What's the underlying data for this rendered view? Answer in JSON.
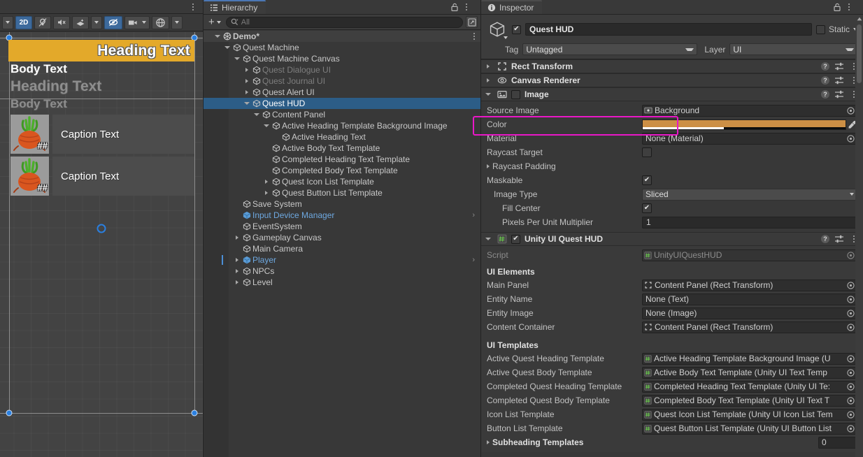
{
  "scene": {
    "toolbar": {
      "dropdown_caret": "▾",
      "mode_2d": "2D",
      "lighting_icon": "lighting-icon",
      "audio_icon": "audio-mute-icon",
      "fx_icon": "effects-icon",
      "fx_caret": "▾",
      "visibility_icon": "scene-visibility-icon",
      "camera_icon": "scene-camera-icon",
      "camera_caret": "▾",
      "gizmos_icon": "gizmos-icon",
      "gizmos_caret": "▾"
    },
    "hud_preview": {
      "heading_text": "Heading Text",
      "body_text": "Body Text",
      "completed_heading_text": "Heading Text",
      "completed_body_text": "Body Text",
      "icon_count_1": "##",
      "caption_1": "Caption Text",
      "icon_count_2": "##",
      "caption_2": "Caption Text",
      "heading_bg_color": "#e3a92a"
    }
  },
  "hierarchy": {
    "tab_label": "Hierarchy",
    "add_label": "",
    "add_caret": "▾",
    "search_placeholder": "All",
    "rows": [
      {
        "label": "Demo*",
        "indent": 1,
        "twist": "open",
        "type": "scene",
        "dim": false,
        "prefab": false,
        "selected": false,
        "kebab": true
      },
      {
        "label": "Quest Machine",
        "indent": 2,
        "twist": "open",
        "type": "go",
        "dim": false,
        "prefab": false,
        "selected": false,
        "kebab": false
      },
      {
        "label": "Quest Machine Canvas",
        "indent": 3,
        "twist": "open",
        "type": "go",
        "dim": false,
        "prefab": false,
        "selected": false,
        "kebab": false
      },
      {
        "label": "Quest Dialogue UI",
        "indent": 4,
        "twist": "closed",
        "type": "go",
        "dim": true,
        "prefab": false,
        "selected": false,
        "kebab": false
      },
      {
        "label": "Quest Journal UI",
        "indent": 4,
        "twist": "closed",
        "type": "go",
        "dim": true,
        "prefab": false,
        "selected": false,
        "kebab": false
      },
      {
        "label": "Quest Alert UI",
        "indent": 4,
        "twist": "closed",
        "type": "go",
        "dim": false,
        "prefab": false,
        "selected": false,
        "kebab": false
      },
      {
        "label": "Quest HUD",
        "indent": 4,
        "twist": "open",
        "type": "go",
        "dim": false,
        "prefab": false,
        "selected": true,
        "kebab": false
      },
      {
        "label": "Content Panel",
        "indent": 5,
        "twist": "open",
        "type": "go",
        "dim": false,
        "prefab": false,
        "selected": false,
        "kebab": false
      },
      {
        "label": "Active Heading Template Background Image",
        "indent": 6,
        "twist": "open",
        "type": "go",
        "dim": false,
        "prefab": false,
        "selected": false,
        "kebab": false
      },
      {
        "label": "Active Heading Text",
        "indent": 7,
        "twist": "none",
        "type": "go",
        "dim": false,
        "prefab": false,
        "selected": false,
        "kebab": false
      },
      {
        "label": "Active Body Text Template",
        "indent": 6,
        "twist": "none",
        "type": "go",
        "dim": false,
        "prefab": false,
        "selected": false,
        "kebab": false
      },
      {
        "label": "Completed Heading Text Template",
        "indent": 6,
        "twist": "none",
        "type": "go",
        "dim": false,
        "prefab": false,
        "selected": false,
        "kebab": false
      },
      {
        "label": "Completed Body Text Template",
        "indent": 6,
        "twist": "none",
        "type": "go",
        "dim": false,
        "prefab": false,
        "selected": false,
        "kebab": false
      },
      {
        "label": "Quest Icon List Template",
        "indent": 6,
        "twist": "closed",
        "type": "go",
        "dim": false,
        "prefab": false,
        "selected": false,
        "kebab": false
      },
      {
        "label": "Quest Button List Template",
        "indent": 6,
        "twist": "closed",
        "type": "go",
        "dim": false,
        "prefab": false,
        "selected": false,
        "kebab": false
      },
      {
        "label": "Save System",
        "indent": 3,
        "twist": "none",
        "type": "go",
        "dim": false,
        "prefab": false,
        "selected": false,
        "kebab": false
      },
      {
        "label": "Input Device Manager",
        "indent": 3,
        "twist": "none",
        "type": "prefab",
        "dim": false,
        "prefab": true,
        "selected": false,
        "kebab": false,
        "chev": "›"
      },
      {
        "label": "EventSystem",
        "indent": 3,
        "twist": "none",
        "type": "go",
        "dim": false,
        "prefab": false,
        "selected": false,
        "kebab": false
      },
      {
        "label": "Gameplay Canvas",
        "indent": 3,
        "twist": "closed",
        "type": "go",
        "dim": false,
        "prefab": false,
        "selected": false,
        "kebab": false
      },
      {
        "label": "Main Camera",
        "indent": 3,
        "twist": "none",
        "type": "go",
        "dim": false,
        "prefab": false,
        "selected": false,
        "kebab": false
      },
      {
        "label": "Player",
        "indent": 3,
        "twist": "closed",
        "type": "prefab",
        "dim": false,
        "prefab": true,
        "selected": false,
        "kebab": false,
        "chev": "›",
        "stripe": true
      },
      {
        "label": "NPCs",
        "indent": 3,
        "twist": "closed",
        "type": "go",
        "dim": false,
        "prefab": false,
        "selected": false,
        "kebab": false
      },
      {
        "label": "Level",
        "indent": 3,
        "twist": "closed",
        "type": "go",
        "dim": false,
        "prefab": false,
        "selected": false,
        "kebab": false
      }
    ]
  },
  "inspector": {
    "tab_label": "Inspector",
    "object_name": "Quest HUD",
    "object_enabled": true,
    "static_label": "Static",
    "static_checked": false,
    "tag_label": "Tag",
    "tag_value": "Untagged",
    "layer_label": "Layer",
    "layer_value": "UI",
    "components": [
      {
        "name": "Rect Transform",
        "expanded": false,
        "icon": "rect-transform-icon",
        "has_toggle": false
      },
      {
        "name": "Canvas Renderer",
        "expanded": false,
        "icon": "canvas-renderer-icon",
        "has_toggle": false
      }
    ],
    "image_component": {
      "name": "Image",
      "expanded": true,
      "enabled": false,
      "rows": {
        "source_image_label": "Source Image",
        "source_image_value": "Background",
        "color_label": "Color",
        "color_value": "#cc8f45",
        "color_alpha_pct": 40,
        "material_label": "Material",
        "material_value": "None (Material)",
        "raycast_target_label": "Raycast Target",
        "raycast_target_checked": false,
        "raycast_padding_label": "Raycast Padding",
        "maskable_label": "Maskable",
        "maskable_checked": true,
        "image_type_label": "Image Type",
        "image_type_value": "Sliced",
        "fill_center_label": "Fill Center",
        "fill_center_checked": true,
        "ppu_label": "Pixels Per Unit Multiplier",
        "ppu_value": "1"
      }
    },
    "script_component": {
      "name": "Unity UI Quest HUD",
      "expanded": true,
      "enabled": true,
      "script_label": "Script",
      "script_value": "UnityUIQuestHUD",
      "ui_elements_title": "UI Elements",
      "ui_elements": [
        {
          "label": "Main Panel",
          "value": "Content Panel (Rect Transform)",
          "badge": "rect-transform-icon"
        },
        {
          "label": "Entity Name",
          "value": "None (Text)",
          "badge": "none"
        },
        {
          "label": "Entity Image",
          "value": "None (Image)",
          "badge": "none"
        },
        {
          "label": "Content Container",
          "value": "Content Panel (Rect Transform)",
          "badge": "rect-transform-icon"
        }
      ],
      "ui_templates_title": "UI Templates",
      "ui_templates": [
        {
          "label": "Active Quest Heading Template",
          "value": "Active Heading Template Background Image (U",
          "badge": "script-icon"
        },
        {
          "label": "Active Quest Body Template",
          "value": "Active Body Text Template (Unity UI Text Temp",
          "badge": "script-icon"
        },
        {
          "label": "Completed Quest Heading Template",
          "value": "Completed Heading Text Template (Unity UI Te:",
          "badge": "script-icon"
        },
        {
          "label": "Completed Quest Body Template",
          "value": "Completed Body Text Template (Unity UI Text T",
          "badge": "script-icon"
        },
        {
          "label": "Icon List Template",
          "value": "Quest Icon List Template (Unity UI Icon List Tem",
          "badge": "script-icon"
        },
        {
          "label": "Button List Template",
          "value": "Quest Button List Template (Unity UI Button List",
          "badge": "script-icon"
        }
      ],
      "subheading_label": "Subheading Templates",
      "subheading_value": "0"
    }
  }
}
